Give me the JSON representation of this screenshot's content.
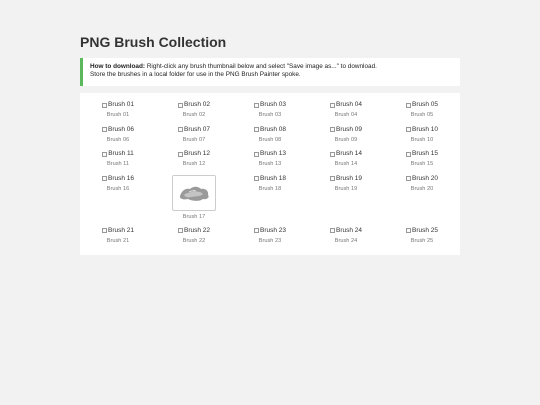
{
  "page": {
    "title": "PNG Brush Collection"
  },
  "notice": {
    "label": "How to download:",
    "line1": "Right-click any brush thumbnail below and select \"Save image as...\" to download.",
    "line2": "Store the brushes in a local folder for use in the PNG Brush Painter spoke."
  },
  "brushes": [
    {
      "alt": "Brush 01",
      "caption": "Brush 01"
    },
    {
      "alt": "Brush 02",
      "caption": "Brush 02"
    },
    {
      "alt": "Brush 03",
      "caption": "Brush 03"
    },
    {
      "alt": "Brush 04",
      "caption": "Brush 04"
    },
    {
      "alt": "Brush 05",
      "caption": "Brush 05"
    },
    {
      "alt": "Brush 06",
      "caption": "Brush 06"
    },
    {
      "alt": "Brush 07",
      "caption": "Brush 07"
    },
    {
      "alt": "Brush 08",
      "caption": "Brush 08"
    },
    {
      "alt": "Brush 09",
      "caption": "Brush 09"
    },
    {
      "alt": "Brush 10",
      "caption": "Brush 10"
    },
    {
      "alt": "Brush 11",
      "caption": "Brush 11"
    },
    {
      "alt": "Brush 12",
      "caption": "Brush 12"
    },
    {
      "alt": "Brush 13",
      "caption": "Brush 13"
    },
    {
      "alt": "Brush 14",
      "caption": "Brush 14"
    },
    {
      "alt": "Brush 15",
      "caption": "Brush 15"
    },
    {
      "alt": "Brush 16",
      "caption": "Brush 16"
    },
    {
      "alt": "",
      "caption": "Brush 17"
    },
    {
      "alt": "Brush 18",
      "caption": "Brush 18"
    },
    {
      "alt": "Brush 19",
      "caption": "Brush 19"
    },
    {
      "alt": "Brush 20",
      "caption": "Brush 20"
    },
    {
      "alt": "Brush 21",
      "caption": "Brush 21"
    },
    {
      "alt": "Brush 22",
      "caption": "Brush 22"
    },
    {
      "alt": "Brush 23",
      "caption": "Brush 23"
    },
    {
      "alt": "Brush 24",
      "caption": "Brush 24"
    },
    {
      "alt": "Brush 25",
      "caption": "Brush 25"
    }
  ],
  "colors": {
    "background": "#f2f2f2",
    "accent": "#5cb85c"
  }
}
